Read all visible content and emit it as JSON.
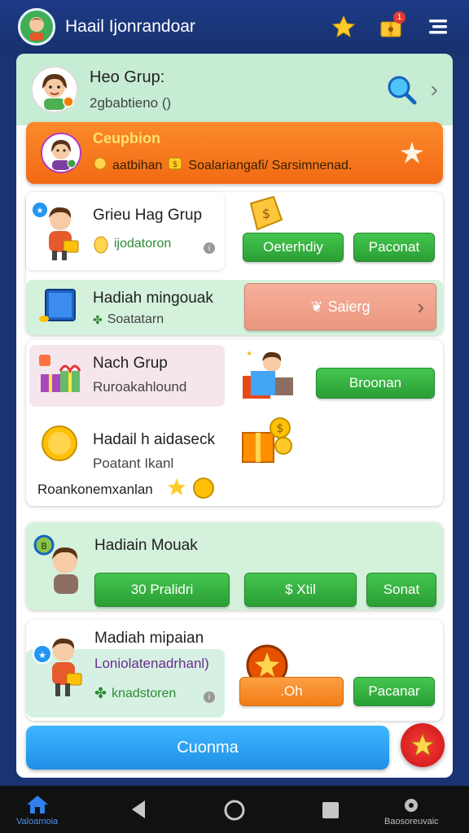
{
  "app": {
    "title": "Haail Ijonrandoar",
    "notification_count": "1"
  },
  "group_header": {
    "title": "Heo Grup:",
    "subtitle": "2gbabtieno ()"
  },
  "promo": {
    "title": "Ceupbion",
    "item1": "aatbihan",
    "item2": "Soalariangafi/ Sarsimnenad."
  },
  "section1": {
    "row1": {
      "title": "Grieu Hag Grup",
      "sub": "ijodatoron",
      "btn1": "Oeterhdiy",
      "btn2": "Paconat"
    },
    "row2": {
      "title": "Hadiah mingouak",
      "sub": "Soatatarn",
      "btn": "Saierg"
    }
  },
  "section2": {
    "row1": {
      "title": "Nach Grup",
      "sub": "Ruroakahlound",
      "btn": "Broonan"
    },
    "row2": {
      "title": "Hadail h aidaseck",
      "sub": "Poatant Ikanl",
      "footer": "Roankonemxanlan"
    }
  },
  "section3": {
    "title": "Hadiain Mouak",
    "btn1": "30 Pralidri",
    "btn2": "$ Xtil",
    "btn3": "Sonat"
  },
  "section4": {
    "title": "Madiah mipaian",
    "sub": "Loniolatenadrhanl)",
    "sub2": "knadstoren",
    "btn1": ".Oh",
    "btn2": "Pacanar"
  },
  "cta": {
    "label": "Cuonma"
  },
  "bottom_nav": {
    "home_label": "Valoamoia",
    "right_label": "Baosoreuvaic"
  },
  "colors": {
    "accent_green": "#2a9e34",
    "accent_orange": "#f26a14",
    "accent_blue": "#1f8fe6",
    "header_bg": "#17316f"
  }
}
